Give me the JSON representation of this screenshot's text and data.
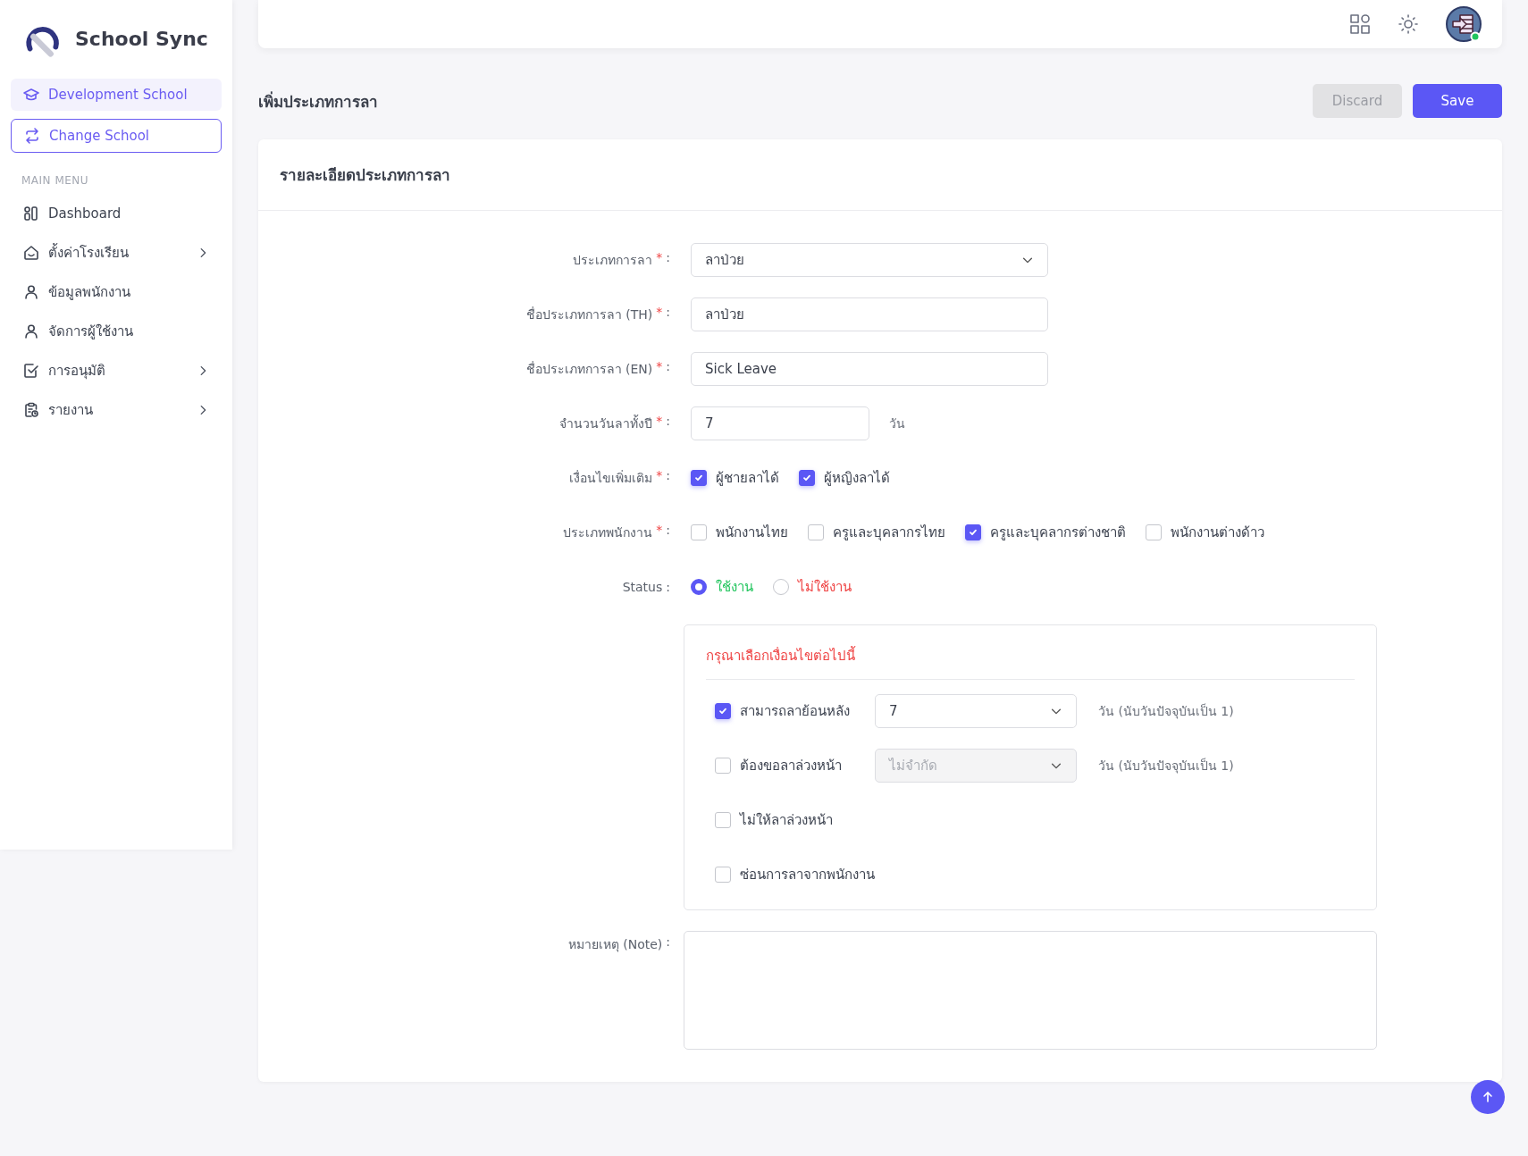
{
  "sidebar": {
    "brand": "School Sync",
    "school": {
      "label": "Development School"
    },
    "change_button": {
      "label": "Change School"
    },
    "section_label": "MAIN MENU",
    "items": [
      {
        "label": "Dashboard",
        "expandable": false
      },
      {
        "label": "ตั้งค่าโรงเรียน",
        "expandable": true
      },
      {
        "label": "ข้อมูลพนักงาน",
        "expandable": false
      },
      {
        "label": "จัดการผู้ใช้งาน",
        "expandable": false
      },
      {
        "label": "การอนุมัติ",
        "expandable": true
      },
      {
        "label": "รายงาน",
        "expandable": true
      }
    ]
  },
  "page": {
    "title": "เพิ่มประเภทการลา",
    "buttons": [
      {
        "label": "Discard",
        "kind": "secondary",
        "disabled": true
      },
      {
        "label": "Save",
        "kind": "primary",
        "disabled": false
      }
    ]
  },
  "card": {
    "title": "รายละเอียดประเภทการลา",
    "fields": [
      {
        "kind": "select",
        "label": "ประเภทการลา",
        "required": "*",
        "colon": ":",
        "value": "ลาป่วย"
      },
      {
        "kind": "text",
        "label": "ชื่อประเภทการลา (TH)",
        "required": "*",
        "colon": ":",
        "value": "ลาป่วย"
      },
      {
        "kind": "text",
        "label": "ชื่อประเภทการลา (EN)",
        "required": "*",
        "colon": ":",
        "value": "Sick Leave"
      },
      {
        "kind": "number",
        "label": "จำนวนวันลาทั้งปี",
        "required": "*",
        "colon": ":",
        "value": "7",
        "suffix": "วัน"
      },
      {
        "kind": "checkboxes",
        "label": "เงื่อนไขเพิ่มเติม",
        "required": "*",
        "colon": ":",
        "options": [
          {
            "label": "ผู้ชายลาได้",
            "checked": true
          },
          {
            "label": "ผู้หญิงลาได้",
            "checked": true
          }
        ]
      },
      {
        "kind": "checkboxes",
        "label": "ประเภทพนักงาน",
        "required": "*",
        "colon": ":",
        "options": [
          {
            "label": "พนักงานไทย",
            "checked": false
          },
          {
            "label": "ครูและบุคลากรไทย",
            "checked": false
          },
          {
            "label": "ครูและบุคลากรต่างชาติ",
            "checked": true
          },
          {
            "label": "พนักงานต่างด้าว",
            "checked": false
          }
        ]
      },
      {
        "kind": "radios",
        "label": "Status",
        "colon": ":",
        "options": [
          {
            "label": "ใช้งาน",
            "selected": true,
            "color": "#22c55e"
          },
          {
            "label": "ไม่ใช้งาน",
            "selected": false,
            "color": "#ef4444"
          }
        ]
      }
    ],
    "conditions": {
      "title": "กรุณาเลือกเงื่อนไขต่อไปนี้",
      "items": [
        {
          "kind": "select",
          "label": "สามารถลาย้อนหลัง",
          "checked": true,
          "value": "7",
          "disabled": false,
          "suffix": "วัน (นับวันปัจจุบันเป็น 1)"
        },
        {
          "kind": "select",
          "label": "ต้องขอลาล่วงหน้า",
          "checked": false,
          "value": "ไม่จำกัด",
          "disabled": true,
          "suffix": "วัน (นับวันปัจจุบันเป็น 1)"
        },
        {
          "kind": "plain",
          "label": "ไม่ให้ลาล่วงหน้า",
          "checked": false
        },
        {
          "kind": "plain",
          "label": "ซ่อนการลาจากพนักงาน",
          "checked": false
        }
      ]
    },
    "note": {
      "label": "หมายเหตุ (Note)",
      "colon": ":"
    }
  }
}
